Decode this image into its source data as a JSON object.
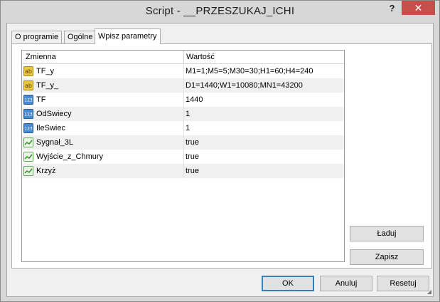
{
  "window": {
    "title": "Script - __PRZESZUKAJ_ICHI",
    "help_glyph": "?",
    "close_glyph": "✕"
  },
  "tabs": [
    {
      "label": "O programie",
      "active": false
    },
    {
      "label": "Ogólne",
      "active": false
    },
    {
      "label": "Wpisz parametry",
      "active": true
    }
  ],
  "grid": {
    "columns": [
      "Zmienna",
      "Wartość"
    ],
    "rows": [
      {
        "name": "TF_y",
        "value": "M1=1;M5=5;M30=30;H1=60;H4=240",
        "type": "string-icon"
      },
      {
        "name": "TF_y_",
        "value": "D1=1440;W1=10080;MN1=43200",
        "type": "string-icon"
      },
      {
        "name": "TF",
        "value": "1440",
        "type": "integer-icon"
      },
      {
        "name": "OdSwiecy",
        "value": "1",
        "type": "integer-icon"
      },
      {
        "name": "IleSwiec",
        "value": "1",
        "type": "integer-icon"
      },
      {
        "name": "Sygnał_3L",
        "value": "true",
        "type": "boolean-icon"
      },
      {
        "name": "Wyjście_z_Chmury",
        "value": "true",
        "type": "boolean-icon"
      },
      {
        "name": "Krzyż",
        "value": "true",
        "type": "boolean-icon"
      }
    ]
  },
  "side_buttons": {
    "load": "Ładuj",
    "save": "Zapisz"
  },
  "footer_buttons": {
    "ok": "OK",
    "cancel": "Anuluj",
    "reset": "Resetuj"
  },
  "colors": {
    "close": "#c74f4b",
    "string_icon": "#e8c640",
    "integer_icon": "#4a8ad0",
    "boolean_icon": "#5bb04f"
  }
}
